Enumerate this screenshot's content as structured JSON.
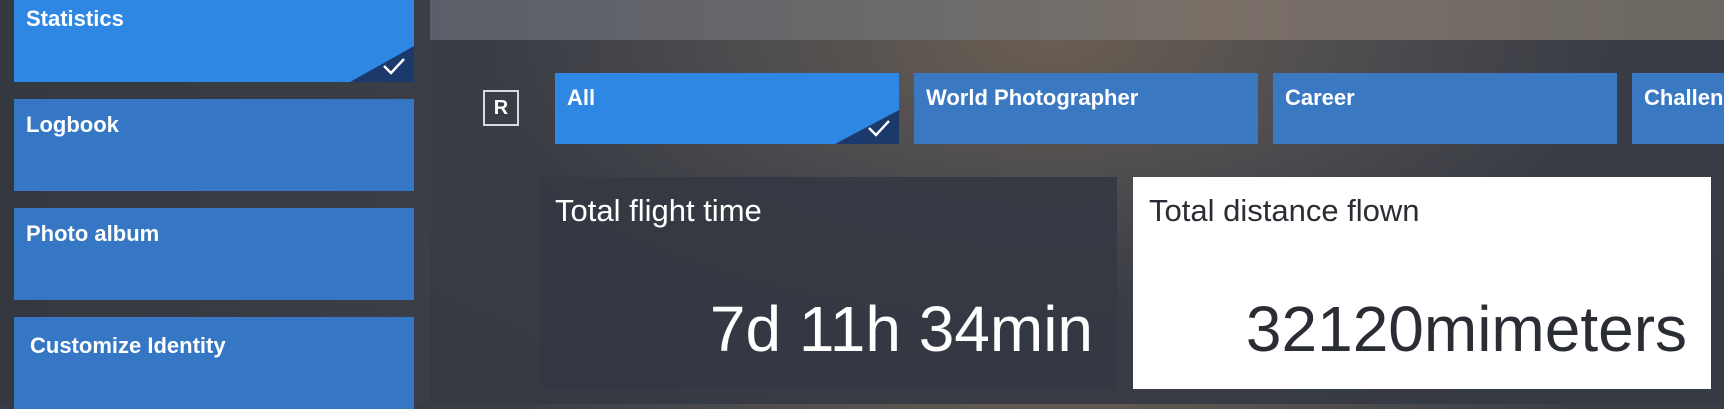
{
  "sidebar": {
    "items": [
      {
        "label": "Statistics",
        "active": true
      },
      {
        "label": "Logbook",
        "active": false
      },
      {
        "label": "Photo album",
        "active": false
      },
      {
        "label": "Customize Identity",
        "active": false
      }
    ]
  },
  "filter": {
    "key_hint": "R",
    "tabs": [
      {
        "label": "All",
        "active": true
      },
      {
        "label": "World Photographer",
        "active": false
      },
      {
        "label": "Career",
        "active": false
      },
      {
        "label": "Challen",
        "active": false
      }
    ]
  },
  "stats": [
    {
      "title": "Total flight time",
      "value": "7d 11h 34min",
      "selected": false
    },
    {
      "title": "Total distance flown",
      "value": "32120mimeters",
      "selected": true
    }
  ],
  "colors": {
    "tab_active": "#2f87e4",
    "tab_inactive": "#3a79c2",
    "check_corner": "#1b3a6b",
    "card_dark": "#343842",
    "card_selected": "#ffffff"
  },
  "icons": {
    "selected_marker": "checkmark-icon"
  }
}
